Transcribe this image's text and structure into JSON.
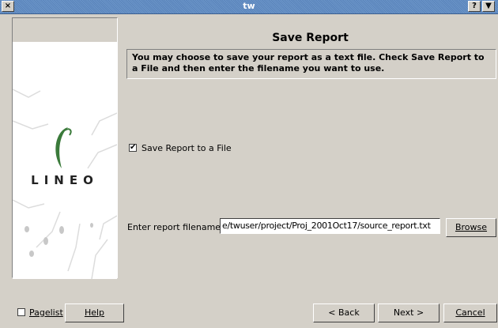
{
  "window": {
    "title": "tw",
    "close_glyph": "×",
    "help_glyph": "?",
    "menu_glyph": "▼"
  },
  "sidebar": {
    "logo_text": "LINEO"
  },
  "page": {
    "heading": "Save Report",
    "description": "You may choose to save your report as a text file. Check Save Report to a File and then enter the filename you want to use."
  },
  "save_option": {
    "label": "Save Report to a File",
    "checked": true
  },
  "filename": {
    "label": "Enter report filename:",
    "value": "e/twuser/project/Proj_2001Oct17/source_report.txt",
    "browse_label": "Browse"
  },
  "footer": {
    "pagelist_label": "Pagelist",
    "pagelist_checked": false,
    "help_label": "Help",
    "back_label": "< Back",
    "next_label": "Next >",
    "cancel_label": "Cancel"
  }
}
